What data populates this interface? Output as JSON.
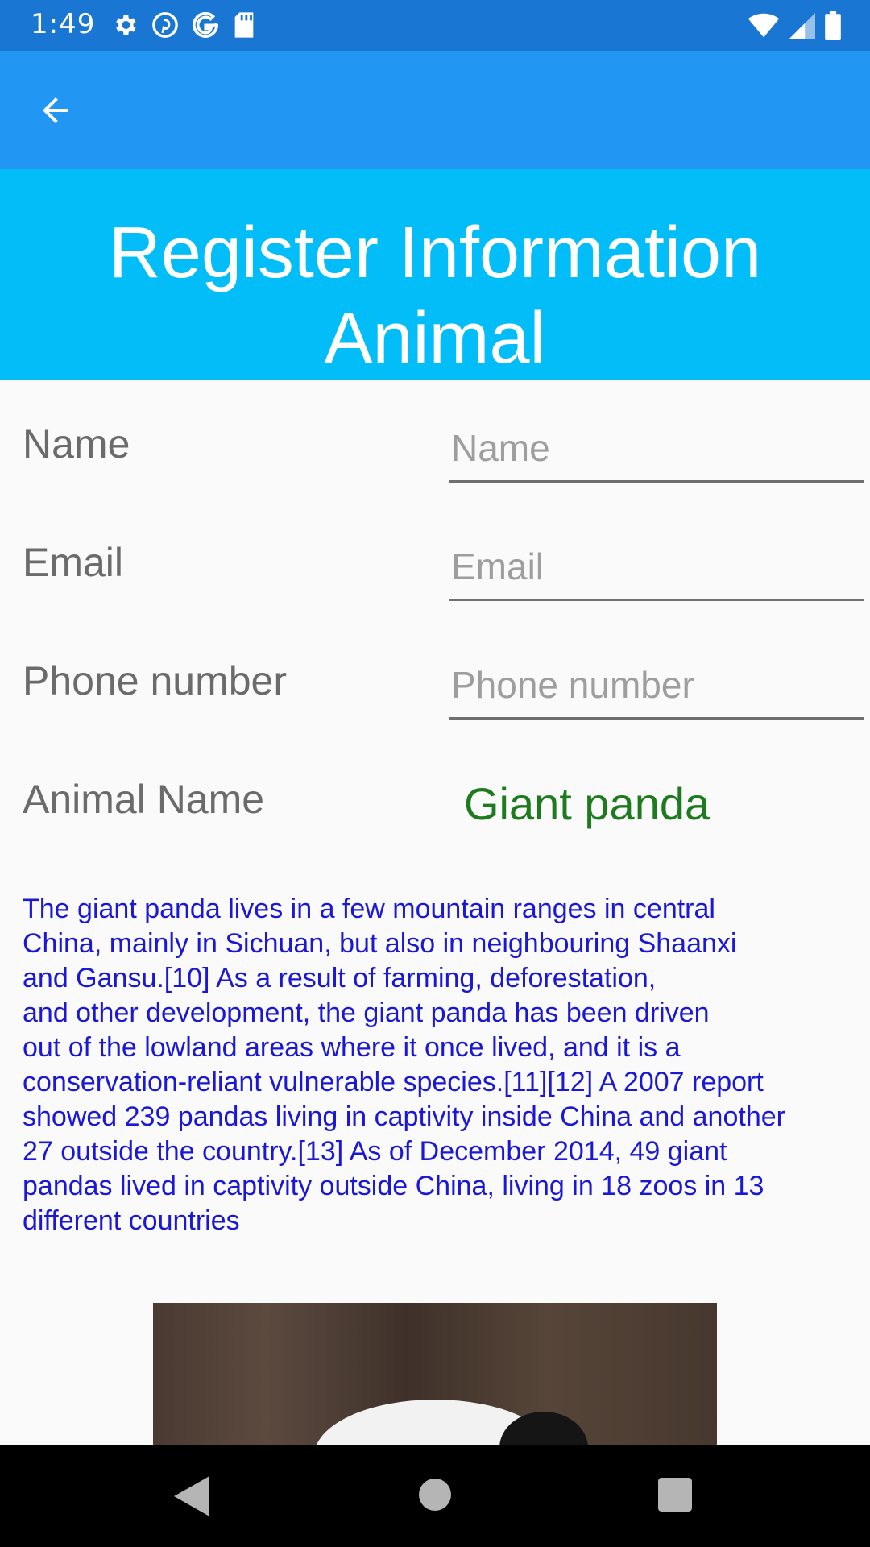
{
  "status_bar": {
    "time": "1:49",
    "left_icons": [
      "gear-icon",
      "pinterest-icon",
      "google-icon",
      "sd-card-icon"
    ],
    "right_icons": [
      "wifi-icon",
      "signal-icon",
      "battery-icon"
    ]
  },
  "app_bar": {
    "back_icon": "arrow-back-icon"
  },
  "header": {
    "title_line1": "Register Information",
    "title_line2": "Animal"
  },
  "form": {
    "name_label": "Name",
    "name_placeholder": "Name",
    "email_label": "Email",
    "email_placeholder": "Email",
    "phone_label": "Phone number",
    "phone_placeholder": "Phone number",
    "animal_label": "Animal Name",
    "animal_value": "Giant panda"
  },
  "description": "The giant panda lives in a few mountain ranges in central\nChina, mainly in Sichuan, but also in neighbouring Shaanxi\nand Gansu.[10] As a result of farming, deforestation,\nand other development, the giant panda has been driven\nout of the lowland areas where it once lived, and it is a\nconservation-reliant vulnerable species.[11][12] A 2007 report\nshowed 239 pandas living in captivity inside China and another\n27 outside the country.[13] As of December 2014, 49 giant\npandas lived in captivity outside China, living in 18 zoos in 13\ndifferent countries",
  "image": {
    "subject": "giant panda photo"
  },
  "nav_bar": {
    "icons": [
      "back-triangle-icon",
      "home-circle-icon",
      "recents-square-icon"
    ]
  },
  "colors": {
    "status_bar": "#1976d2",
    "app_bar": "#2196f3",
    "header": "#03bdf8",
    "animal_value": "#1e7a1e",
    "description": "#1a18d6"
  }
}
